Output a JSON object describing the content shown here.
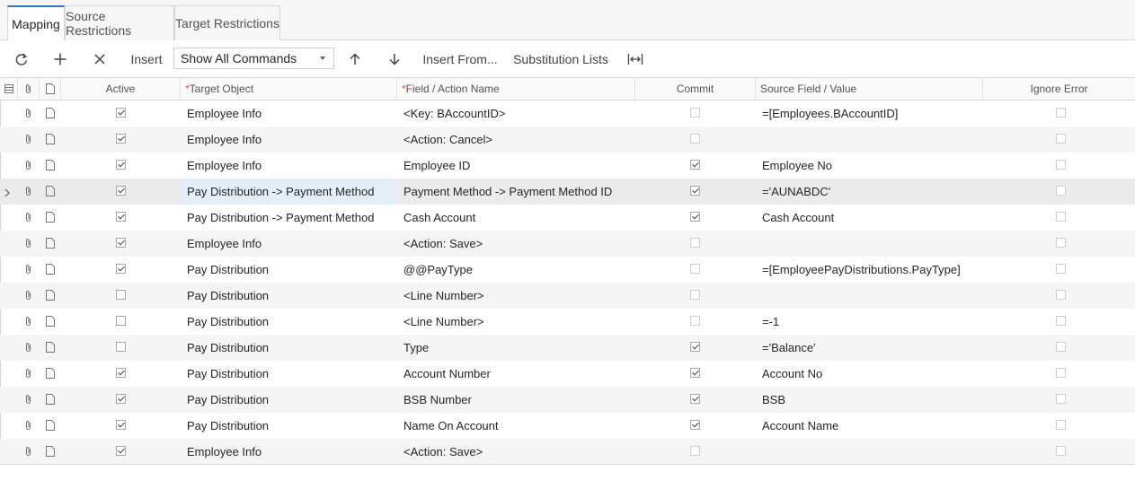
{
  "tabs": [
    {
      "label": "Mapping",
      "active": true
    },
    {
      "label": "Source Restrictions",
      "active": false
    },
    {
      "label": "Target Restrictions",
      "active": false
    }
  ],
  "toolbar": {
    "refresh_icon": "refresh-icon",
    "add_icon": "plus-icon",
    "delete_icon": "close-icon",
    "insert_label": "Insert",
    "command_filter": "Show All Commands",
    "move_up_icon": "arrow-up-icon",
    "move_down_icon": "arrow-down-icon",
    "insert_from_label": "Insert From...",
    "substitution_lists_label": "Substitution Lists",
    "fit_columns_icon": "fit-columns-icon"
  },
  "columns": {
    "active": "Active",
    "target_object": "Target Object",
    "field_action": "Field / Action Name",
    "commit": "Commit",
    "source_field": "Source Field / Value",
    "ignore_error": "Ignore Error",
    "required_mark": "*"
  },
  "rows": [
    {
      "active": true,
      "target": "Employee Info",
      "field": "<Key: BAccountID>",
      "commit": false,
      "source": "=[Employees.BAccountID]",
      "ignore": false
    },
    {
      "active": true,
      "target": "Employee Info",
      "field": "<Action: Cancel>",
      "commit": false,
      "source": "",
      "ignore": false
    },
    {
      "active": true,
      "target": "Employee Info",
      "field": "Employee ID",
      "commit": true,
      "source": "Employee No",
      "ignore": false
    },
    {
      "active": true,
      "target": "Pay Distribution -> Payment Method",
      "field": "Payment Method -> Payment Method ID",
      "commit": true,
      "source": "='AUNABDC'",
      "ignore": false,
      "selected": true
    },
    {
      "active": true,
      "target": "Pay Distribution -> Payment Method",
      "field": "Cash Account",
      "commit": true,
      "source": "Cash Account",
      "ignore": false
    },
    {
      "active": true,
      "target": "Employee Info",
      "field": "<Action: Save>",
      "commit": false,
      "source": "",
      "ignore": false
    },
    {
      "active": true,
      "target": "Pay Distribution",
      "field": "@@PayType",
      "commit": false,
      "source": "=[EmployeePayDistributions.PayType]",
      "ignore": false
    },
    {
      "active": false,
      "target": "Pay Distribution",
      "field": "<Line Number>",
      "commit": false,
      "source": "",
      "ignore": false
    },
    {
      "active": false,
      "target": "Pay Distribution",
      "field": "<Line Number>",
      "commit": false,
      "source": "=-1",
      "ignore": false
    },
    {
      "active": false,
      "target": "Pay Distribution",
      "field": "Type",
      "commit": true,
      "source": "='Balance'",
      "ignore": false
    },
    {
      "active": true,
      "target": "Pay Distribution",
      "field": "Account Number",
      "commit": true,
      "source": "Account No",
      "ignore": false
    },
    {
      "active": true,
      "target": "Pay Distribution",
      "field": "BSB Number",
      "commit": true,
      "source": "BSB",
      "ignore": false
    },
    {
      "active": true,
      "target": "Pay Distribution",
      "field": "Name On Account",
      "commit": true,
      "source": "Account Name",
      "ignore": false
    },
    {
      "active": true,
      "target": "Employee Info",
      "field": "<Action: Save>",
      "commit": false,
      "source": "",
      "ignore": false
    }
  ]
}
